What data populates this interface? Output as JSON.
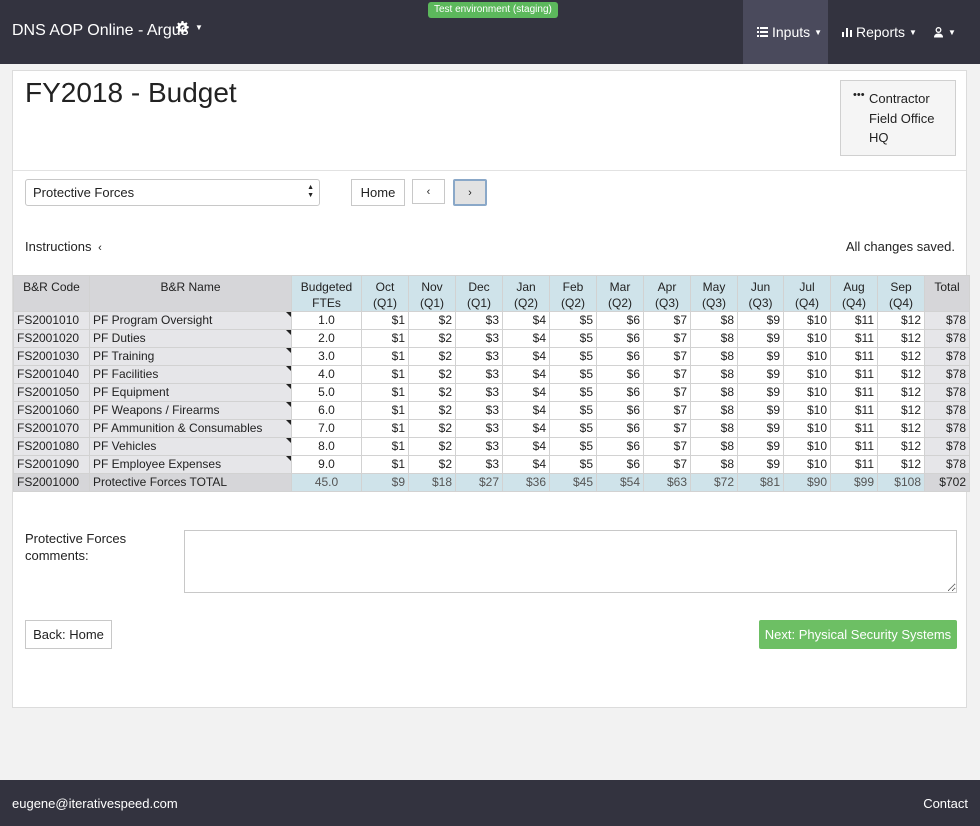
{
  "navbar": {
    "brand": "DNS AOP Online - Argus",
    "env_badge": "Test environment (staging)",
    "menus": {
      "inputs": "Inputs",
      "reports": "Reports"
    }
  },
  "page": {
    "title": "FY2018 - Budget",
    "org_levels": [
      "Contractor",
      "Field Office",
      "HQ"
    ],
    "category_select": "Protective Forces",
    "home_button": "Home",
    "prev_glyph": "‹",
    "next_glyph": "›",
    "instructions_label": "Instructions",
    "save_status": "All changes saved."
  },
  "table": {
    "headers": {
      "code": "B&R Code",
      "name": "B&R Name",
      "fte_line1": "Budgeted",
      "fte_line2": "FTEs",
      "months": [
        {
          "m": "Oct",
          "q": "(Q1)"
        },
        {
          "m": "Nov",
          "q": "(Q1)"
        },
        {
          "m": "Dec",
          "q": "(Q1)"
        },
        {
          "m": "Jan",
          "q": "(Q2)"
        },
        {
          "m": "Feb",
          "q": "(Q2)"
        },
        {
          "m": "Mar",
          "q": "(Q2)"
        },
        {
          "m": "Apr",
          "q": "(Q3)"
        },
        {
          "m": "May",
          "q": "(Q3)"
        },
        {
          "m": "Jun",
          "q": "(Q3)"
        },
        {
          "m": "Jul",
          "q": "(Q4)"
        },
        {
          "m": "Aug",
          "q": "(Q4)"
        },
        {
          "m": "Sep",
          "q": "(Q4)"
        }
      ],
      "total": "Total"
    },
    "rows": [
      {
        "code": "FS2001010",
        "name": "PF Program Oversight",
        "fte": "1.0",
        "months": [
          "$1",
          "$2",
          "$3",
          "$4",
          "$5",
          "$6",
          "$7",
          "$8",
          "$9",
          "$10",
          "$11",
          "$12"
        ],
        "total": "$78"
      },
      {
        "code": "FS2001020",
        "name": "PF Duties",
        "fte": "2.0",
        "months": [
          "$1",
          "$2",
          "$3",
          "$4",
          "$5",
          "$6",
          "$7",
          "$8",
          "$9",
          "$10",
          "$11",
          "$12"
        ],
        "total": "$78"
      },
      {
        "code": "FS2001030",
        "name": "PF Training",
        "fte": "3.0",
        "months": [
          "$1",
          "$2",
          "$3",
          "$4",
          "$5",
          "$6",
          "$7",
          "$8",
          "$9",
          "$10",
          "$11",
          "$12"
        ],
        "total": "$78"
      },
      {
        "code": "FS2001040",
        "name": "PF Facilities",
        "fte": "4.0",
        "months": [
          "$1",
          "$2",
          "$3",
          "$4",
          "$5",
          "$6",
          "$7",
          "$8",
          "$9",
          "$10",
          "$11",
          "$12"
        ],
        "total": "$78"
      },
      {
        "code": "FS2001050",
        "name": "PF Equipment",
        "fte": "5.0",
        "months": [
          "$1",
          "$2",
          "$3",
          "$4",
          "$5",
          "$6",
          "$7",
          "$8",
          "$9",
          "$10",
          "$11",
          "$12"
        ],
        "total": "$78"
      },
      {
        "code": "FS2001060",
        "name": "PF Weapons / Firearms",
        "fte": "6.0",
        "months": [
          "$1",
          "$2",
          "$3",
          "$4",
          "$5",
          "$6",
          "$7",
          "$8",
          "$9",
          "$10",
          "$11",
          "$12"
        ],
        "total": "$78"
      },
      {
        "code": "FS2001070",
        "name": "PF Ammunition & Consumables",
        "fte": "7.0",
        "months": [
          "$1",
          "$2",
          "$3",
          "$4",
          "$5",
          "$6",
          "$7",
          "$8",
          "$9",
          "$10",
          "$11",
          "$12"
        ],
        "total": "$78"
      },
      {
        "code": "FS2001080",
        "name": "PF Vehicles",
        "fte": "8.0",
        "months": [
          "$1",
          "$2",
          "$3",
          "$4",
          "$5",
          "$6",
          "$7",
          "$8",
          "$9",
          "$10",
          "$11",
          "$12"
        ],
        "total": "$78"
      },
      {
        "code": "FS2001090",
        "name": "PF Employee Expenses",
        "fte": "9.0",
        "months": [
          "$1",
          "$2",
          "$3",
          "$4",
          "$5",
          "$6",
          "$7",
          "$8",
          "$9",
          "$10",
          "$11",
          "$12"
        ],
        "total": "$78"
      }
    ],
    "total_row": {
      "code": "FS2001000",
      "name": "Protective Forces TOTAL",
      "fte": "45.0",
      "months": [
        "$9",
        "$18",
        "$27",
        "$36",
        "$45",
        "$54",
        "$63",
        "$72",
        "$81",
        "$90",
        "$99",
        "$108"
      ],
      "total": "$702"
    }
  },
  "comments": {
    "label": "Protective Forces comments:",
    "value": ""
  },
  "actions": {
    "back": "Back: Home",
    "next": "Next: Physical Security Systems"
  },
  "footer": {
    "email": "eugene@iterativespeed.com",
    "contact": "Contact"
  },
  "colors": {
    "navbar": "#33333f",
    "header_blue": "#cfe3ea",
    "header_grey": "#d6d6d9",
    "next_button": "#6dbf64",
    "env_badge": "#5cb85c"
  }
}
